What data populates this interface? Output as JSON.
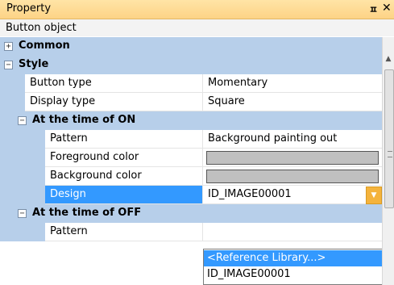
{
  "panel": {
    "title": "Property",
    "pin_icon": "ㅍ",
    "close_icon": "✕",
    "object_name": "Button object"
  },
  "categories": {
    "common": {
      "label": "Common",
      "expander": "+"
    },
    "style": {
      "label": "Style",
      "expander": "−"
    },
    "on": {
      "label": "At the time of ON",
      "expander": "−"
    },
    "off": {
      "label": "At the time of OFF",
      "expander": "−"
    }
  },
  "properties": {
    "button_type": {
      "name": "Button type",
      "value": "Momentary"
    },
    "display_type": {
      "name": "Display type",
      "value": "Square"
    },
    "on_pattern": {
      "name": "Pattern",
      "value": "Background painting out"
    },
    "on_foreground": {
      "name": "Foreground color",
      "color": "#c0c0c0"
    },
    "on_background": {
      "name": "Background color",
      "color": "#c0c0c0"
    },
    "on_design": {
      "name": "Design",
      "value": "ID_IMAGE00001"
    },
    "off_pattern": {
      "name": "Pattern",
      "value": ""
    }
  },
  "dropdown": {
    "options": [
      "<Reference Library...>",
      "ID_IMAGE00001"
    ],
    "highlighted": "<Reference Library...>"
  },
  "colors": {
    "titlebar": "#fdd386",
    "category": "#b7cfea",
    "selection": "#3399ff",
    "combo_button": "#f4b33c"
  }
}
